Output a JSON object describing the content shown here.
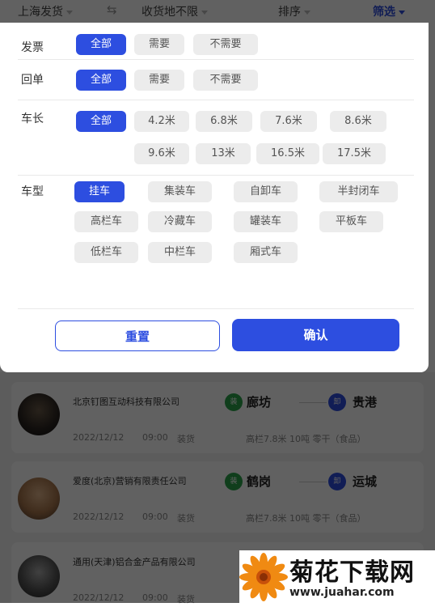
{
  "topbar": {
    "origin": "上海发货",
    "destination": "收货地不限",
    "sort": "排序",
    "filter": "筛选"
  },
  "filter_panel": {
    "invoice": {
      "label": "发票",
      "options": [
        "全部",
        "需要",
        "不需要"
      ],
      "selected": "全部"
    },
    "receipt": {
      "label": "回单",
      "options": [
        "全部",
        "需要",
        "不需要"
      ],
      "selected": "全部"
    },
    "length": {
      "label": "车长",
      "options": [
        "全部",
        "4.2米",
        "6.8米",
        "7.6米",
        "8.6米",
        "9.6米",
        "13米",
        "16.5米",
        "17.5米"
      ],
      "selected": "全部"
    },
    "type": {
      "label": "车型",
      "options": [
        "挂车",
        "集装车",
        "自卸车",
        "半封闭车",
        "高栏车",
        "冷藏车",
        "罐装车",
        "平板车",
        "低栏车",
        "中栏车",
        "厢式车"
      ],
      "selected": "挂车"
    },
    "reset_label": "重置",
    "confirm_label": "确认"
  },
  "listings": [
    {
      "company": "北京钉图互动科技有限公司",
      "from": "廊坊",
      "to": "贵港",
      "from_badge": "装",
      "to_badge": "卸",
      "date": "2022/12/12",
      "time": "09:00",
      "action": "装货",
      "detail": "高栏7.8米 10吨 零干（食品）"
    },
    {
      "company": "爱度(北京)营销有限责任公司",
      "from": "鹤岗",
      "to": "运城",
      "from_badge": "装",
      "to_badge": "卸",
      "date": "2022/12/12",
      "time": "09:00",
      "action": "装货",
      "detail": "高栏7.8米 10吨 零干（食品）"
    },
    {
      "company": "通用(天津)铝合金产品有限公司",
      "from": "",
      "to": "",
      "from_badge": "",
      "to_badge": "",
      "date": "2022/12/12",
      "time": "09:00",
      "action": "装货",
      "detail": ""
    }
  ],
  "watermark": {
    "name": "菊花下载网",
    "url": "www.juahar.com"
  },
  "colors": {
    "accent": "#2d4ee0",
    "chip_bg": "#ececec",
    "overlay": "rgba(0,0,0,0.62)"
  }
}
